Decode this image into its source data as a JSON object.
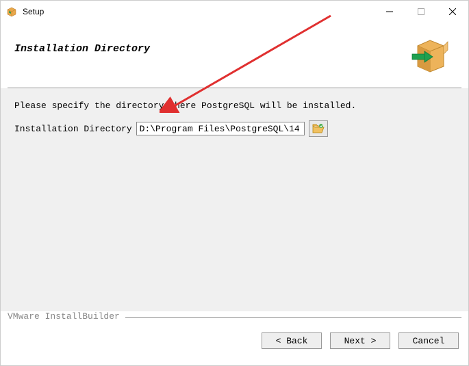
{
  "window": {
    "title": "Setup"
  },
  "header": {
    "heading": "Installation Directory"
  },
  "content": {
    "instruction": "Please specify the directory where PostgreSQL will be installed.",
    "field_label": "Installation Directory",
    "field_value": "D:\\Program Files\\PostgreSQL\\14"
  },
  "footer": {
    "brand": "VMware InstallBuilder",
    "back_label": "< Back",
    "next_label": "Next >",
    "cancel_label": "Cancel"
  }
}
